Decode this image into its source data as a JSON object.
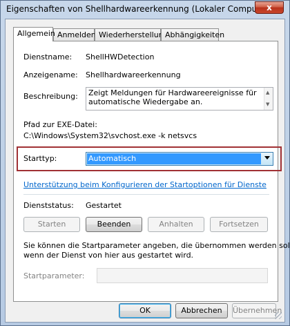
{
  "window": {
    "title": "Eigenschaften von Shellhardwareerkennung (Lokaler Computer)",
    "close_glyph": "x"
  },
  "tabs": [
    {
      "label": "Allgemein",
      "active": true
    },
    {
      "label": "Anmelden",
      "active": false
    },
    {
      "label": "Wiederherstellung",
      "active": false
    },
    {
      "label": "Abhängigkeiten",
      "active": false
    }
  ],
  "general": {
    "service_name_label": "Dienstname:",
    "service_name_value": "ShellHWDetection",
    "display_name_label": "Anzeigename:",
    "display_name_value": "Shellhardwareerkennung",
    "description_label": "Beschreibung:",
    "description_value": "Zeigt Meldungen für Hardwareereignisse für automatische Wiedergabe an.",
    "path_label": "Pfad zur EXE-Datei:",
    "path_value": "C:\\Windows\\System32\\svchost.exe -k netsvcs",
    "startup_type_label": "Starttyp:",
    "startup_type_value": "Automatisch",
    "help_link": "Unterstützung beim Konfigurieren der Startoptionen für Dienste",
    "status_label": "Dienststatus:",
    "status_value": "Gestartet",
    "buttons": {
      "start": "Starten",
      "stop": "Beenden",
      "pause": "Anhalten",
      "resume": "Fortsetzen"
    },
    "info_text_1": "Sie können die Startparameter angeben, die übernommen werden sollen,",
    "info_text_2": "wenn der Dienst von hier aus gestartet wird.",
    "start_params_label": "Startparameter:",
    "start_params_value": ""
  },
  "dialog_buttons": {
    "ok": "OK",
    "cancel": "Abbrechen",
    "apply": "Übernehmen"
  },
  "colors": {
    "highlight_border": "#a03034",
    "link": "#0066cc",
    "selection": "#3399ff"
  }
}
